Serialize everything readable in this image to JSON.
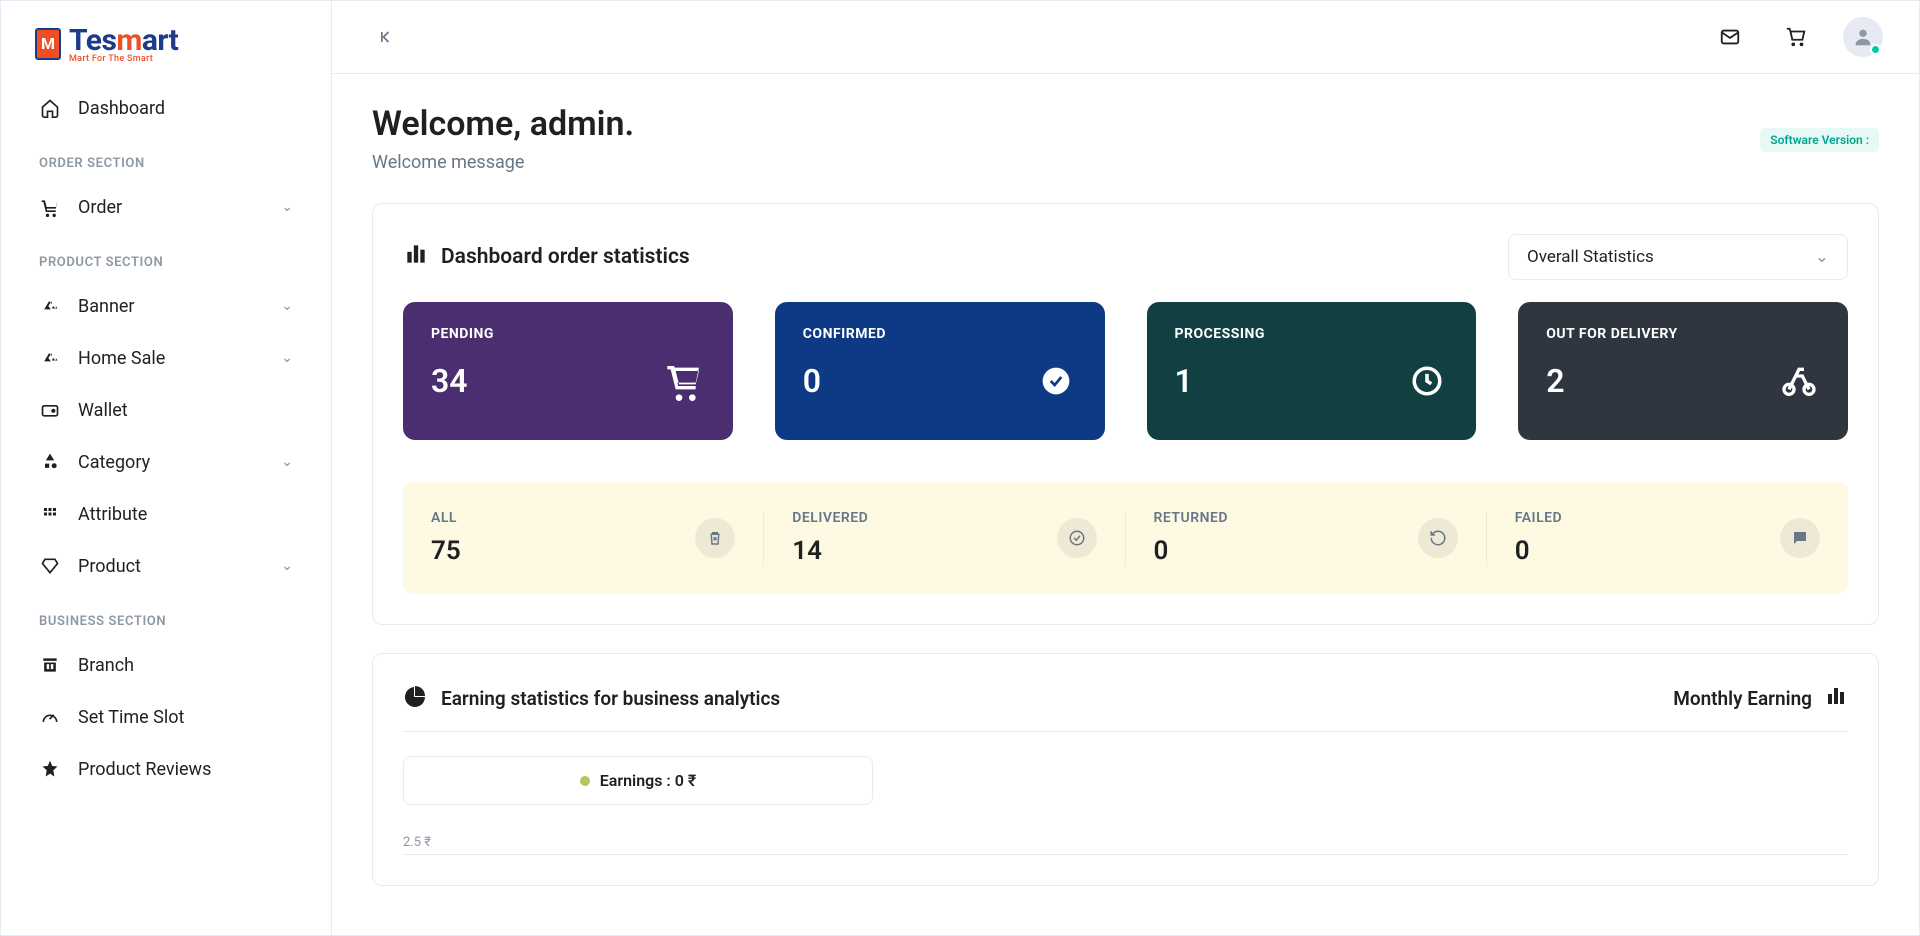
{
  "brand": {
    "name_part1": "Tes",
    "name_part2": "m",
    "name_part3": "art",
    "tagline": "Mart For The Smart"
  },
  "sidebar": {
    "dashboard": "Dashboard",
    "sections": [
      {
        "title": "ORDER SECTION",
        "items": [
          {
            "label": "Order",
            "icon": "cart",
            "expandable": true
          }
        ]
      },
      {
        "title": "PRODUCT SECTION",
        "items": [
          {
            "label": "Banner",
            "icon": "terrain",
            "expandable": true
          },
          {
            "label": "Home Sale",
            "icon": "terrain",
            "expandable": true
          },
          {
            "label": "Wallet",
            "icon": "wallet",
            "expandable": false
          },
          {
            "label": "Category",
            "icon": "category",
            "expandable": true
          },
          {
            "label": "Attribute",
            "icon": "grid",
            "expandable": false
          },
          {
            "label": "Product",
            "icon": "diamond",
            "expandable": true
          }
        ]
      },
      {
        "title": "BUSINESS SECTION",
        "items": [
          {
            "label": "Branch",
            "icon": "store",
            "expandable": false
          },
          {
            "label": "Set Time Slot",
            "icon": "speed",
            "expandable": false
          },
          {
            "label": "Product Reviews",
            "icon": "star",
            "expandable": false
          }
        ]
      }
    ]
  },
  "welcome": {
    "title": "Welcome, admin.",
    "subtitle": "Welcome message"
  },
  "version_label": "Software Version :",
  "stats_title": "Dashboard order statistics",
  "stats_select": "Overall Statistics",
  "cards": [
    {
      "label": "PENDING",
      "value": "34"
    },
    {
      "label": "CONFIRMED",
      "value": "0"
    },
    {
      "label": "PROCESSING",
      "value": "1"
    },
    {
      "label": "OUT FOR DELIVERY",
      "value": "2"
    }
  ],
  "cards2": [
    {
      "label": "ALL",
      "value": "75"
    },
    {
      "label": "DELIVERED",
      "value": "14"
    },
    {
      "label": "RETURNED",
      "value": "0"
    },
    {
      "label": "FAILED",
      "value": "0"
    }
  ],
  "earning": {
    "title": "Earning statistics for business analytics",
    "right": "Monthly Earning",
    "legend": "Earnings : 0 ₹",
    "axis0": "2.5 ₹"
  },
  "chart_data": {
    "type": "line",
    "title": "Earning statistics for business analytics",
    "series": [
      {
        "name": "Earnings",
        "values": [
          0
        ]
      }
    ],
    "ylabel": "₹",
    "ylim": [
      0,
      2.5
    ],
    "legend": "Earnings : 0 ₹"
  }
}
